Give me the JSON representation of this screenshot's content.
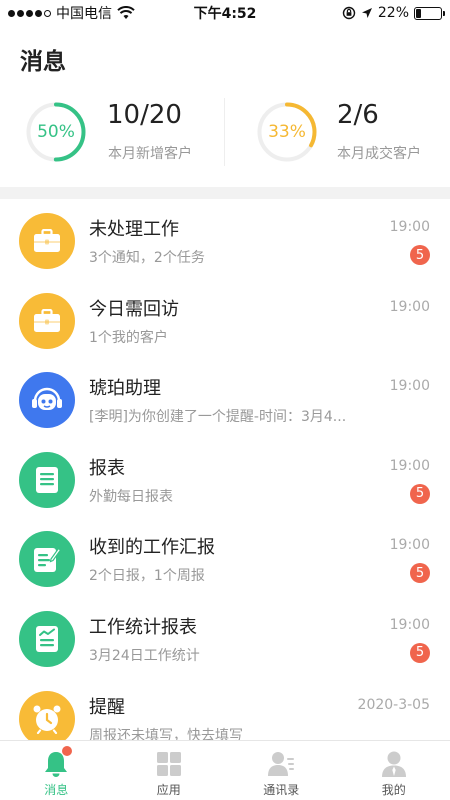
{
  "status_bar": {
    "carrier": "中国电信",
    "time": "下午4:52",
    "battery_text": "22%",
    "battery_level": 0.22,
    "signal_bars_filled": 4,
    "signal_bars_total": 5
  },
  "page": {
    "title": "消息"
  },
  "stats": [
    {
      "percent_text": "50%",
      "fraction": 0.5,
      "value": "10/20",
      "label": "本月新增客户",
      "color": "#35c286"
    },
    {
      "percent_text": "33%",
      "fraction": 0.33,
      "value": "2/6",
      "label": "本月成交客户",
      "color": "#f5b833"
    }
  ],
  "messages": [
    {
      "title": "未处理工作",
      "subtitle": "3个通知，2个任务",
      "time": "19:00",
      "badge": "5",
      "icon": "briefcase-icon",
      "color": "#f8bb37"
    },
    {
      "title": "今日需回访",
      "subtitle": "1个我的客户",
      "time": "19:00",
      "badge": "",
      "icon": "briefcase-icon",
      "color": "#f8bb37"
    },
    {
      "title": "琥珀助理",
      "subtitle": "[李明]为你创建了一个提醒-时间：3月4...",
      "time": "19:00",
      "badge": "",
      "icon": "assistant-robot-icon",
      "color": "#3f78ee"
    },
    {
      "title": "报表",
      "subtitle": "外勤每日报表",
      "time": "19:00",
      "badge": "5",
      "icon": "report-doc-icon",
      "color": "#35c286"
    },
    {
      "title": "收到的工作汇报",
      "subtitle": "2个日报，1个周报",
      "time": "19:00",
      "badge": "5",
      "icon": "edit-doc-icon",
      "color": "#35c286"
    },
    {
      "title": "工作统计报表",
      "subtitle": "3月24日工作统计",
      "time": "19:00",
      "badge": "5",
      "icon": "chart-doc-icon",
      "color": "#35c286"
    },
    {
      "title": "提醒",
      "subtitle": "周报还未填写，快去填写",
      "time": "2020-3-05",
      "badge": "",
      "icon": "alarm-clock-icon",
      "color": "#f8bb37"
    }
  ],
  "tabs": [
    {
      "label": "消息",
      "icon": "bell-icon",
      "active": true
    },
    {
      "label": "应用",
      "icon": "grid-icon",
      "active": false
    },
    {
      "label": "通讯录",
      "icon": "contacts-icon",
      "active": false
    },
    {
      "label": "我的",
      "icon": "profile-icon",
      "active": false
    }
  ],
  "colors": {
    "accent_green": "#35c286",
    "accent_orange": "#f5b833",
    "badge_red": "#f0654d",
    "tab_inactive": "#cccccc"
  }
}
